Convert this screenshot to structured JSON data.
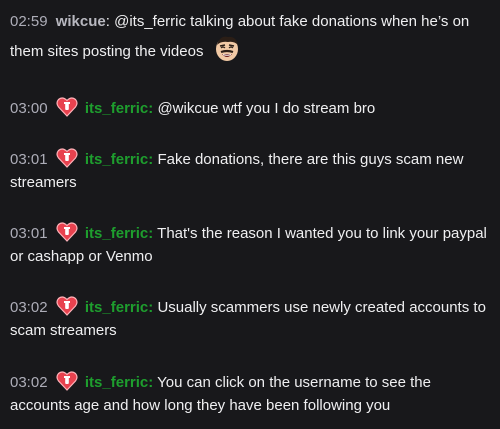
{
  "messages": [
    {
      "time": "02:59",
      "username": "wikcue",
      "text": "@its_ferric talking about fake donations when he’s on them sites posting the videos",
      "badge": "",
      "emote": "laughing-man-emote"
    },
    {
      "time": "03:00",
      "username": "its_ferric",
      "text": "@wikcue wtf you I do stream bro",
      "badge": "heart-badge-icon"
    },
    {
      "time": "03:01",
      "username": "its_ferric",
      "text": "Fake donations, there are this guys scam new streamers",
      "badge": "heart-badge-icon"
    },
    {
      "time": "03:01",
      "username": "its_ferric",
      "text": "That's the reason I wanted you to link your paypal or cashapp or Venmo",
      "badge": "heart-badge-icon"
    },
    {
      "time": "03:02",
      "username": "its_ferric",
      "text": "Usually scammers use newly created accounts to scam streamers",
      "badge": "heart-badge-icon"
    },
    {
      "time": "03:02",
      "username": "its_ferric",
      "text": "You can click on the username to see the accounts age and how long they have been following you",
      "badge": "heart-badge-icon"
    }
  ],
  "colors": {
    "background": "#18181b",
    "timestamp": "#adadb8",
    "username_green": "#1e9e2e",
    "username_gray": "#b8b8c0",
    "text": "#efeff1",
    "badge_red": "#e8424f"
  }
}
